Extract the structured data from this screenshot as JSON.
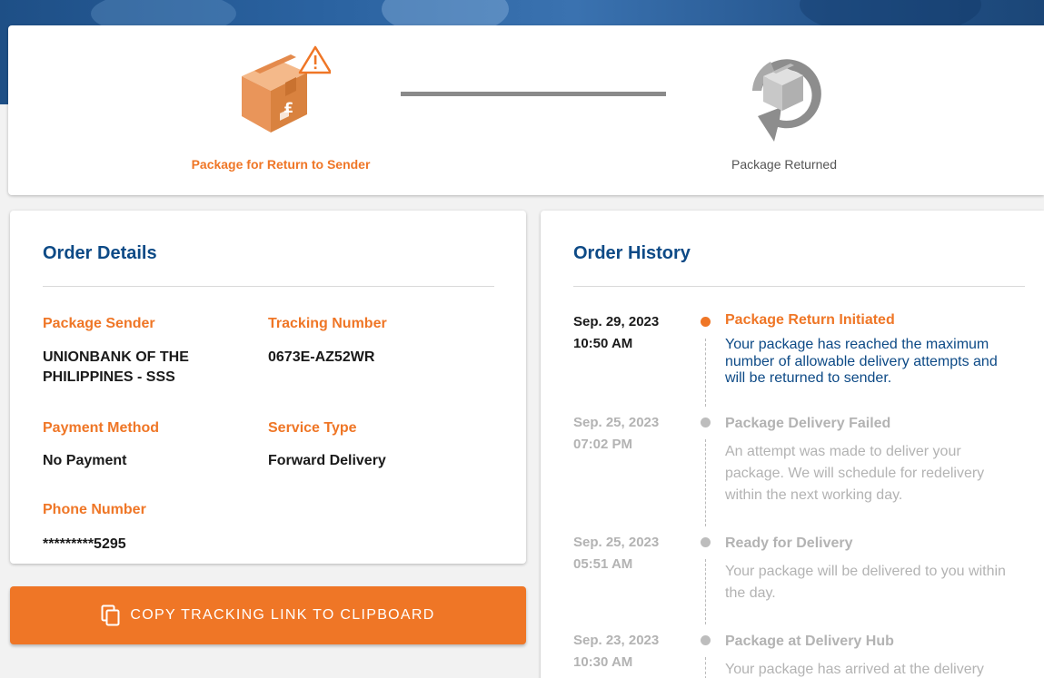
{
  "progress": {
    "steps": [
      {
        "label": "Package for Return to Sender",
        "icon": "package-warning-icon",
        "state": "current"
      },
      {
        "label": "Package Returned",
        "icon": "package-returned-icon",
        "state": "pending"
      }
    ]
  },
  "order_details": {
    "title": "Order Details",
    "sender_label": "Package Sender",
    "sender_value": "UNIONBANK OF THE PHILIPPINES - SSS",
    "tracking_label": "Tracking Number",
    "tracking_value": "0673E-AZ52WR",
    "payment_label": "Payment Method",
    "payment_value": "No Payment",
    "service_label": "Service Type",
    "service_value": "Forward Delivery",
    "phone_label": "Phone Number",
    "phone_value": "*********5295"
  },
  "copy_button": {
    "label": "COPY TRACKING LINK TO CLIPBOARD",
    "icon": "copy-icon"
  },
  "order_history": {
    "title": "Order History",
    "events": [
      {
        "date": "Sep. 29, 2023",
        "time": "10:50 AM",
        "title": "Package Return Initiated",
        "description": "Your package has reached the maximum number of allowable delivery attempts and will be returned to sender."
      },
      {
        "date": "Sep. 25, 2023",
        "time": "07:02 PM",
        "title": "Package Delivery Failed",
        "description": "An attempt was made to deliver your package. We will schedule for redelivery within the next working day."
      },
      {
        "date": "Sep. 25, 2023",
        "time": "05:51 AM",
        "title": "Ready for Delivery",
        "description": "Your package will be delivered to you within the day."
      },
      {
        "date": "Sep. 23, 2023",
        "time": "10:30 AM",
        "title": "Package at Delivery Hub",
        "description": "Your package has arrived at the delivery"
      }
    ]
  },
  "colors": {
    "accent": "#ef7626",
    "heading": "#0d4a86",
    "muted": "#b3b3b3"
  }
}
